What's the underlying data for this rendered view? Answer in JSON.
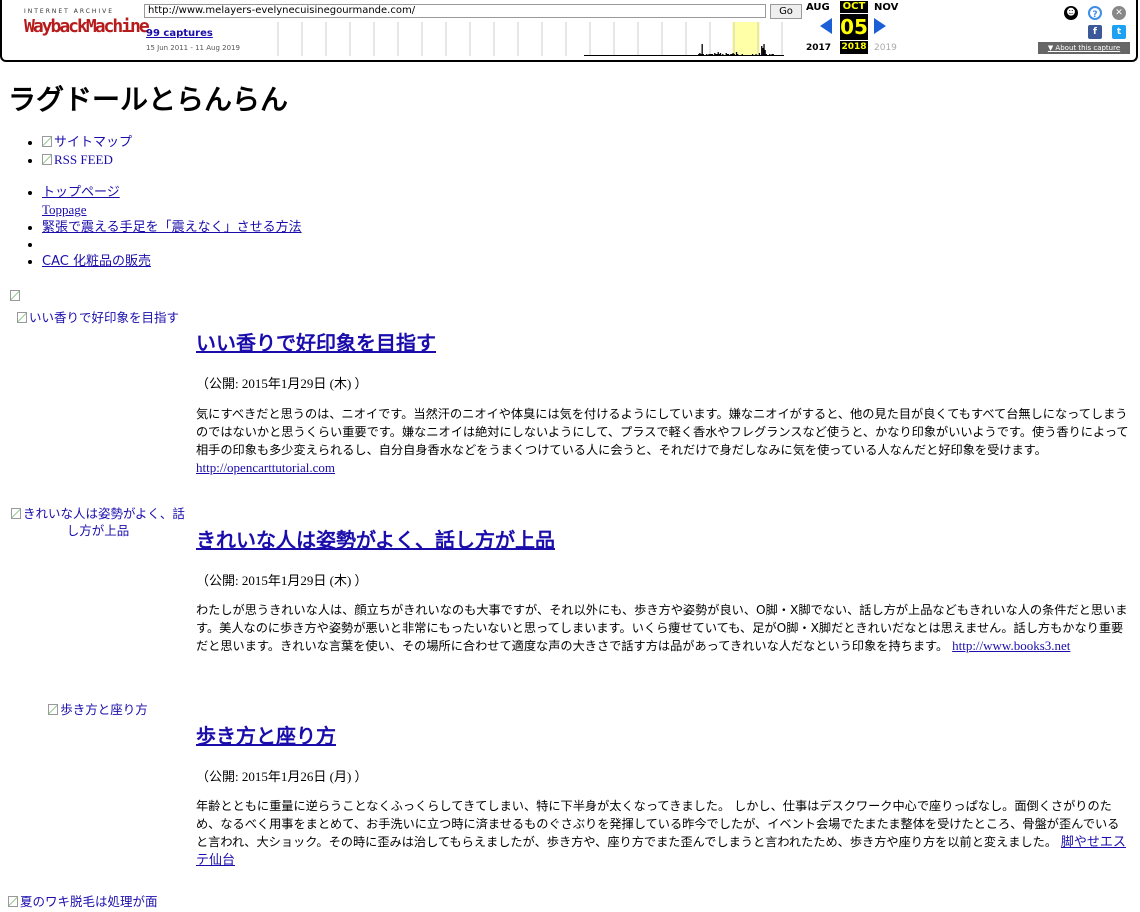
{
  "wayback": {
    "logo_top": "INTERNET ARCHIVE",
    "logo_main": "WaybackMachine",
    "url": "http://www.melayers-evelynecuisinegourmande.com/",
    "go": "Go",
    "captures": "99 captures",
    "range": "15 Jun 2011 - 11 Aug 2019",
    "prev_month": "AUG",
    "cur_month": "OCT",
    "next_month": "NOV",
    "day": "05",
    "prev_year": "2017",
    "cur_year": "2018",
    "next_year": "2019",
    "about": "▼ About this capture",
    "spark_heights": [
      0,
      0,
      0,
      0,
      0,
      0,
      0,
      0,
      0,
      0,
      0,
      0,
      0,
      0,
      0,
      0,
      0,
      0,
      0,
      0,
      0,
      0,
      0,
      0,
      0,
      0,
      0,
      0,
      0,
      0,
      0,
      0,
      0,
      0,
      0,
      0,
      0,
      0,
      0,
      0,
      0,
      0,
      0,
      0,
      0,
      0,
      0,
      0,
      0,
      0,
      0,
      0,
      0,
      0,
      0,
      0,
      0,
      0,
      0,
      0,
      0,
      0,
      0,
      0,
      0,
      0,
      0,
      0,
      0,
      0,
      0,
      0,
      0,
      0,
      0,
      0,
      0,
      0,
      0,
      0,
      0,
      0,
      0,
      0,
      0,
      0,
      0,
      0,
      0,
      0,
      0,
      0,
      0,
      0,
      0,
      0,
      0,
      0,
      0,
      0,
      0,
      0,
      0,
      0,
      0,
      0,
      0,
      0,
      0,
      0,
      0,
      0,
      0,
      0,
      0,
      0,
      0,
      0,
      0,
      0,
      0,
      0,
      0,
      0,
      0,
      0,
      0,
      0,
      0,
      0,
      0,
      0,
      0,
      0,
      0,
      0,
      0,
      0,
      0,
      0,
      0,
      0,
      0,
      0,
      0,
      0,
      0,
      0,
      0,
      0,
      0,
      0,
      0,
      0,
      0,
      0,
      0,
      0,
      0,
      0,
      0,
      0,
      0,
      0,
      0,
      0,
      0,
      0,
      0,
      0,
      0,
      0,
      0,
      0,
      0,
      0,
      0,
      0,
      0,
      0,
      0,
      0,
      0,
      0,
      0,
      0,
      0,
      0,
      0,
      0,
      0,
      0,
      0,
      0,
      0,
      0,
      0,
      0,
      0,
      0,
      0,
      0,
      0,
      0,
      0,
      0,
      0,
      0,
      0,
      0,
      0,
      0,
      0,
      0,
      0,
      0,
      0,
      0,
      0,
      0,
      0,
      0,
      0,
      0,
      0,
      0,
      0,
      0,
      0,
      0,
      0,
      0,
      0,
      0,
      0,
      0,
      0,
      0,
      0,
      0,
      0,
      0,
      0,
      0,
      0,
      0,
      0,
      0,
      0,
      0,
      0,
      0,
      0,
      0,
      0,
      0,
      0,
      0,
      0,
      0,
      0,
      0,
      0,
      0,
      0,
      0,
      0,
      0,
      0,
      0,
      0,
      0,
      0,
      0,
      0,
      0,
      0,
      0,
      0,
      0,
      0,
      0,
      0,
      0,
      0,
      0,
      0,
      0,
      0,
      0,
      0,
      0,
      0,
      0,
      0,
      0,
      0,
      0,
      0,
      0,
      0,
      0,
      0,
      0,
      0,
      0,
      0,
      0,
      0,
      0,
      0,
      0,
      0,
      0,
      0,
      0,
      0,
      0,
      0,
      0,
      0,
      0,
      0,
      0,
      0,
      0,
      0,
      0,
      0,
      0,
      0,
      0,
      0,
      0,
      0,
      0,
      0,
      0,
      0,
      0,
      0,
      0,
      0,
      0,
      0,
      0,
      0,
      0,
      0,
      0,
      0,
      0,
      0,
      0,
      0,
      0,
      0,
      0,
      0,
      0,
      0,
      0,
      0,
      0,
      0,
      0,
      0,
      0,
      0,
      0,
      0,
      0,
      0,
      0,
      0,
      0,
      0,
      0,
      0,
      2,
      3,
      2,
      12,
      2,
      0,
      0,
      2,
      0,
      2,
      2,
      2,
      2,
      0,
      3,
      2,
      2,
      4,
      2,
      3,
      0,
      2,
      0,
      0,
      3,
      2,
      2,
      0,
      2,
      2,
      3,
      2,
      0,
      4,
      2,
      0,
      0,
      0,
      2,
      0,
      0,
      0,
      0,
      0,
      0,
      0,
      0,
      2,
      0,
      0,
      2,
      0,
      0,
      3,
      0,
      10,
      8,
      12,
      6,
      2,
      0,
      0,
      2,
      0,
      2,
      2,
      0,
      0,
      0,
      0,
      0,
      0,
      0,
      0,
      0
    ]
  },
  "site": {
    "title": "ラグドールとらんらん",
    "top_links": [
      "サイトマップ",
      "RSS FEED"
    ],
    "nav": [
      {
        "label": "トップページ",
        "sub": "Toppage"
      },
      {
        "label": "緊張で震える手足を「震えなく」させる方法"
      },
      {
        "label": ""
      },
      {
        "label": "CAC 化粧品の販売"
      }
    ]
  },
  "articles": [
    {
      "image_alt": "いい香りで好印象を目指す",
      "title": "いい香りで好印象を目指す",
      "date": "（公開: 2015年1月29日 (木) ）",
      "body": "気にすべきだと思うのは、ニオイです。当然汗のニオイや体臭には気を付けるようにしています。嫌なニオイがすると、他の見た目が良くてもすべて台無しになってしまうのではないかと思うくらい重要です。嫌なニオイは絶対にしないようにして、プラスで軽く香水やフレグランスなど使うと、かなり印象がいいようです。使う香りによって相手の印象も多少変えられるし、自分自身香水などをうまくつけている人に会うと、それだけで身だしなみに気を使っている人なんだと好印象を受けます。",
      "link": "http://opencarttutorial.com"
    },
    {
      "image_alt": "きれいな人は姿勢がよく、話し方が上品",
      "title": "きれいな人は姿勢がよく、話し方が上品",
      "date": "（公開: 2015年1月29日 (木) ）",
      "body": "わたしが思うきれいな人は、顔立ちがきれいなのも大事ですが、それ以外にも、歩き方や姿勢が良い、O脚・X脚でない、話し方が上品などもきれいな人の条件だと思います。美人なのに歩き方や姿勢が悪いと非常にもったいないと思ってしまいます。いくら痩せていても、足がO脚・X脚だときれいだなとは思えません。話し方もかなり重要だと思います。きれいな言葉を使い、その場所に合わせて適度な声の大きさで話す方は品があってきれいな人だなという印象を持ちます。",
      "link": "http://www.books3.net"
    },
    {
      "image_alt": "歩き方と座り方",
      "title": "歩き方と座り方",
      "date": "（公開: 2015年1月26日 (月) ）",
      "body": "年齢とともに重量に逆らうことなくふっくらしてきてしまい、特に下半身が太くなってきました。 しかし、仕事はデスクワーク中心で座りっぱなし。面倒くさがりのため、なるべく用事をまとめて、お手洗いに立つ時に済ませるものぐさぶりを発揮している昨今でしたが、イベント会場でたまたま整体を受けたところ、骨盤が歪んでいると言われ、大ショック。その時に歪みは治してもらえましたが、歩き方や、座り方でまた歪んでしまうと言われたため、歩き方や座り方を以前と変えました。",
      "link": "脚やせエステ仙台"
    },
    {
      "image_alt": "夏のワキ脱毛は処理が面"
    }
  ]
}
